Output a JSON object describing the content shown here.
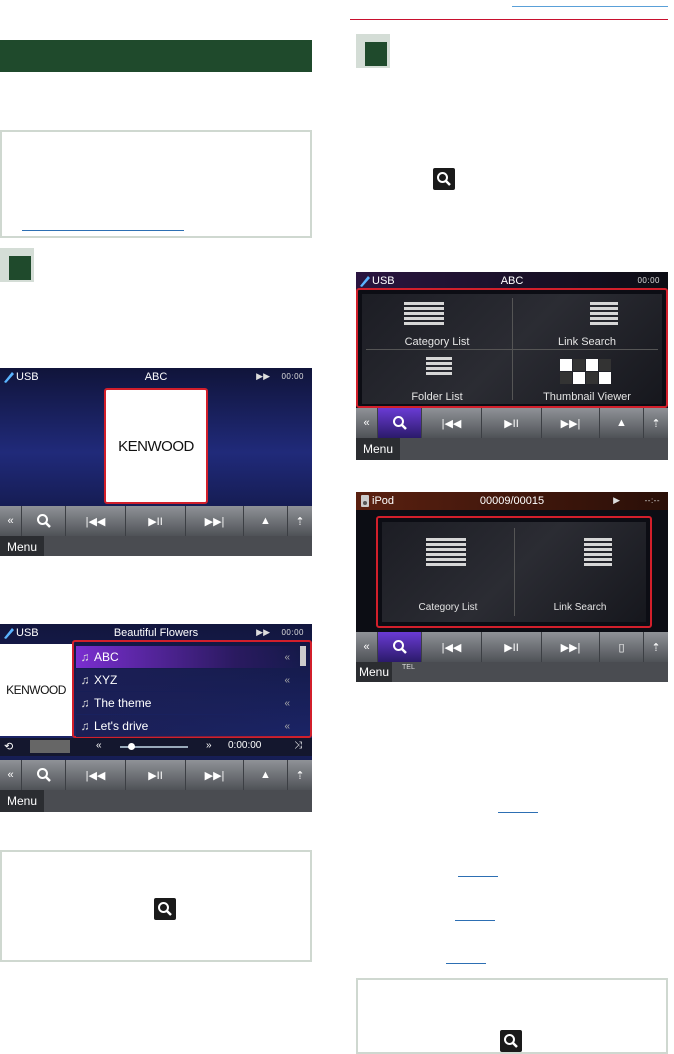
{
  "colors": {
    "section_bar": "#1f4a2c",
    "highlight_frame": "#d21f2b",
    "link": "#2d6fb3",
    "note_border": "#cfd8d0"
  },
  "screen_usb_playback": {
    "source": "USB",
    "title": "ABC",
    "play_state": "▶▶",
    "clock": "00:00",
    "album_art_text": "KENWOOD",
    "controls": {
      "back": "«",
      "search": "search-icon",
      "prev": "|◀◀",
      "play_pause": "▶II",
      "next": "▶▶|",
      "eject": "▲",
      "top": "⇡"
    },
    "menu_label": "Menu"
  },
  "screen_usb_list": {
    "source": "USB",
    "title": "Beautiful Flowers",
    "play_state": "▶▶",
    "clock": "00:00",
    "album_art_text": "KENWOOD",
    "tracks": [
      "ABC",
      "XYZ",
      "The theme",
      "Let's drive"
    ],
    "elapsed": "0:00:00",
    "menu_label": "Menu"
  },
  "screen_usb_search": {
    "source": "USB",
    "title": "ABC",
    "clock": "00:00",
    "tiles": [
      "Category List",
      "Link Search",
      "Folder List",
      "Thumbnail Viewer"
    ],
    "menu_label": "Menu"
  },
  "screen_ipod_search": {
    "source": "iPod",
    "title": "00009/00015",
    "play_state": "▶",
    "clock": "--:--",
    "tiles": [
      "Category List",
      "Link Search"
    ],
    "menu_label": "Menu",
    "tel_label": "TEL"
  }
}
